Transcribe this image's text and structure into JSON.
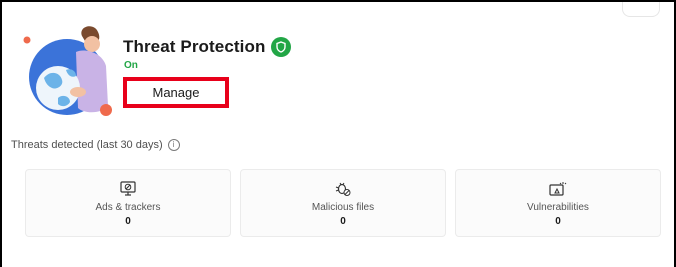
{
  "card": {
    "title": "Threat Protection",
    "status": "On",
    "manage_label": "Manage"
  },
  "threats": {
    "label": "Threats detected (last 30 days)",
    "info_glyph": "i",
    "items": [
      {
        "label": "Ads & trackers",
        "count": "0",
        "icon": "blocked-screen-icon"
      },
      {
        "label": "Malicious files",
        "count": "0",
        "icon": "bug-blocked-icon"
      },
      {
        "label": "Vulnerabilities",
        "count": "0",
        "icon": "vulnerability-icon"
      }
    ]
  },
  "colors": {
    "status_green": "#22a646",
    "highlight_red": "#e8001a"
  }
}
